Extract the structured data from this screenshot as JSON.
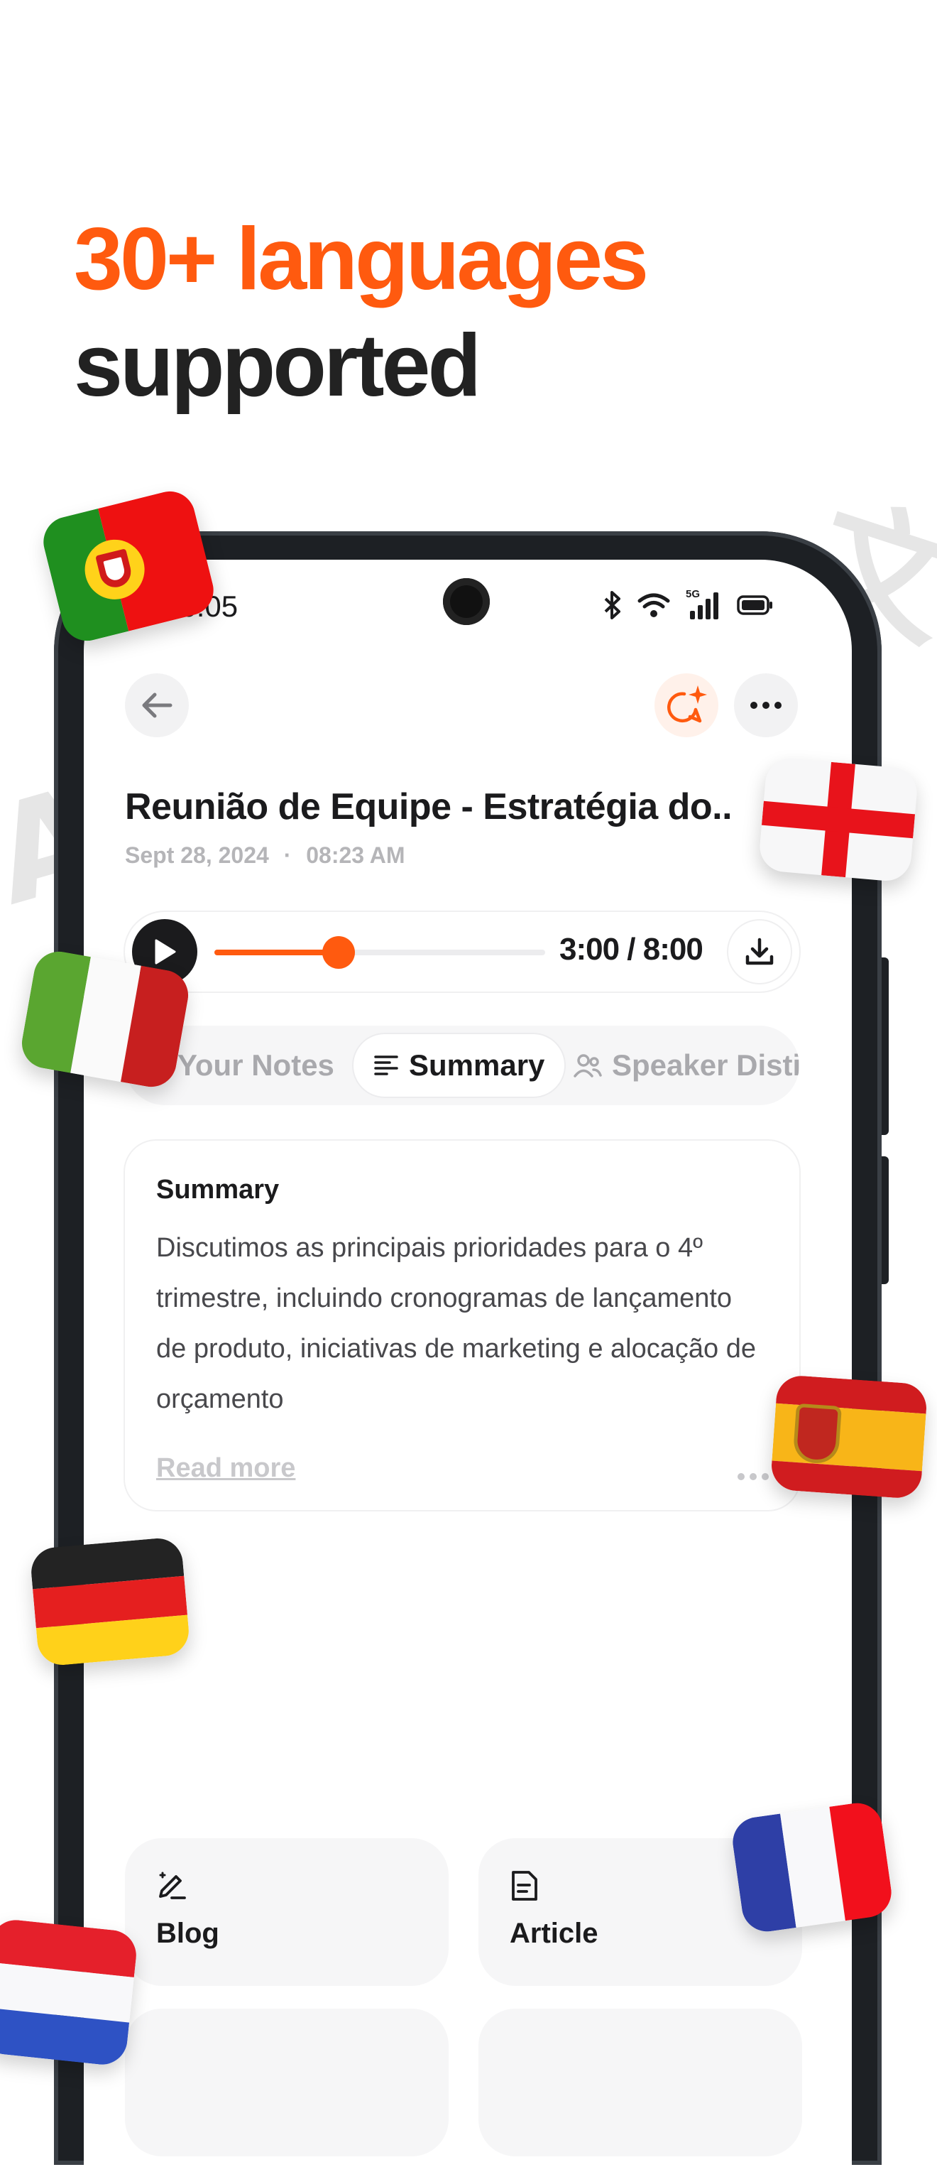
{
  "headline": {
    "line1": "30+ languages",
    "line2": "supported"
  },
  "colors": {
    "accent": "#ff5a0f",
    "dark": "#1b1b1d",
    "muted": "#a9a9ad"
  },
  "status_bar": {
    "time": "16:05",
    "icons": [
      "bluetooth-icon",
      "wifi-icon",
      "5g-signal-icon",
      "battery-icon"
    ],
    "network_label": "5G"
  },
  "header": {
    "back_icon": "arrow-left-icon",
    "ai_icon": "sparkle-chat-icon",
    "more_icon": "more-horizontal-icon"
  },
  "recording": {
    "title": "Reunião de Equipe - Estratégia do..",
    "date": "Sept 28, 2024",
    "separator": "·",
    "time": "08:23 AM"
  },
  "player": {
    "time_display": "3:00 / 8:00",
    "progress": 0.375,
    "play_icon": "play-icon",
    "download_icon": "download-icon"
  },
  "tabs": [
    {
      "label": "Your Notes",
      "icon": "notes-icon",
      "active": false
    },
    {
      "label": "Summary",
      "icon": "lines-icon",
      "active": true
    },
    {
      "label": "Speaker Distinc",
      "icon": "people-icon",
      "active": false
    }
  ],
  "summary": {
    "heading": "Summary",
    "text": "Discutimos as principais prioridades para o 4º trimestre, incluindo cronogramas de lançamento de produto, iniciativas de marketing e alocação de orçamento",
    "read_more": "Read more"
  },
  "actions": [
    {
      "label": "Blog",
      "icon": "pen-icon"
    },
    {
      "label": "Article",
      "icon": "document-icon"
    }
  ],
  "decorations": {
    "bg_glyph_right": "文A",
    "bg_glyph_left": "A"
  }
}
